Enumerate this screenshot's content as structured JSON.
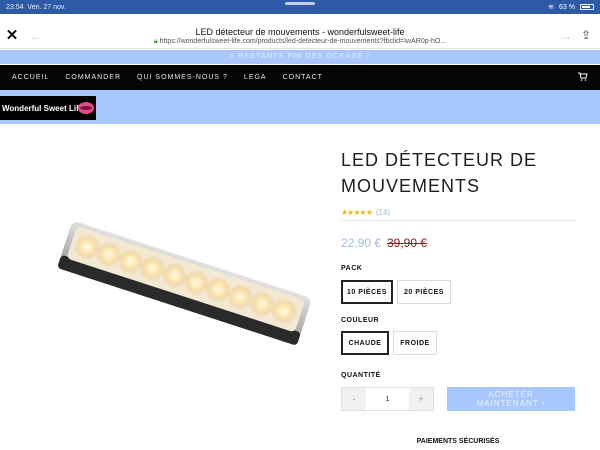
{
  "status_bar": {
    "time": "23:54",
    "date": "Ven. 27 nov.",
    "battery": "63 %"
  },
  "browser": {
    "page_title": "LED détecteur de mouvements - wonderfulsweet-life",
    "url": "https://wonderfulsweet-life.com/products/led-detecteur-de-mouvements?fbclid=IwAR0p-hO..."
  },
  "promo_banner": {
    "text": "6 RESTANTS FIN DES OCKAGE !"
  },
  "nav": {
    "items": [
      "ACCUEIL",
      "COMMANDER",
      "QUI SOMMES-NOUS ?",
      "LEGA",
      "CONTACT"
    ]
  },
  "logo": {
    "text": "Wonderful Sweet Life"
  },
  "product": {
    "title": "LED DÉTECTEUR DE MOUVEMENTS",
    "rating_stars": "★★★★★",
    "rating": 5,
    "review_count": "(14)",
    "price": "22,90 €",
    "old_price": "39,90 €",
    "pack_label": "PACK",
    "pack_options": [
      "10 PIÈCES",
      "20 PIÈCES"
    ],
    "pack_selected": "10 PIÈCES",
    "color_label": "COULEUR",
    "color_options": [
      "CHAUDE",
      "FROIDE"
    ],
    "color_selected": "CHAUDE",
    "quantity_label": "QUANTITÉ",
    "quantity": "1",
    "minus": "-",
    "plus": "+",
    "buy_line1": "ACHETER",
    "buy_line2": "MAINTENANT ›",
    "secure_payments": "PAIEMENTS SÉCURISÉS"
  },
  "colors": {
    "accent_blue": "#a8c7ff",
    "status_blue": "#2d5aa5",
    "nav_black": "#050505",
    "price_blue": "#9ebbf0",
    "old_price_red": "#8b1e1e",
    "star_gold": "#e7b91d"
  }
}
